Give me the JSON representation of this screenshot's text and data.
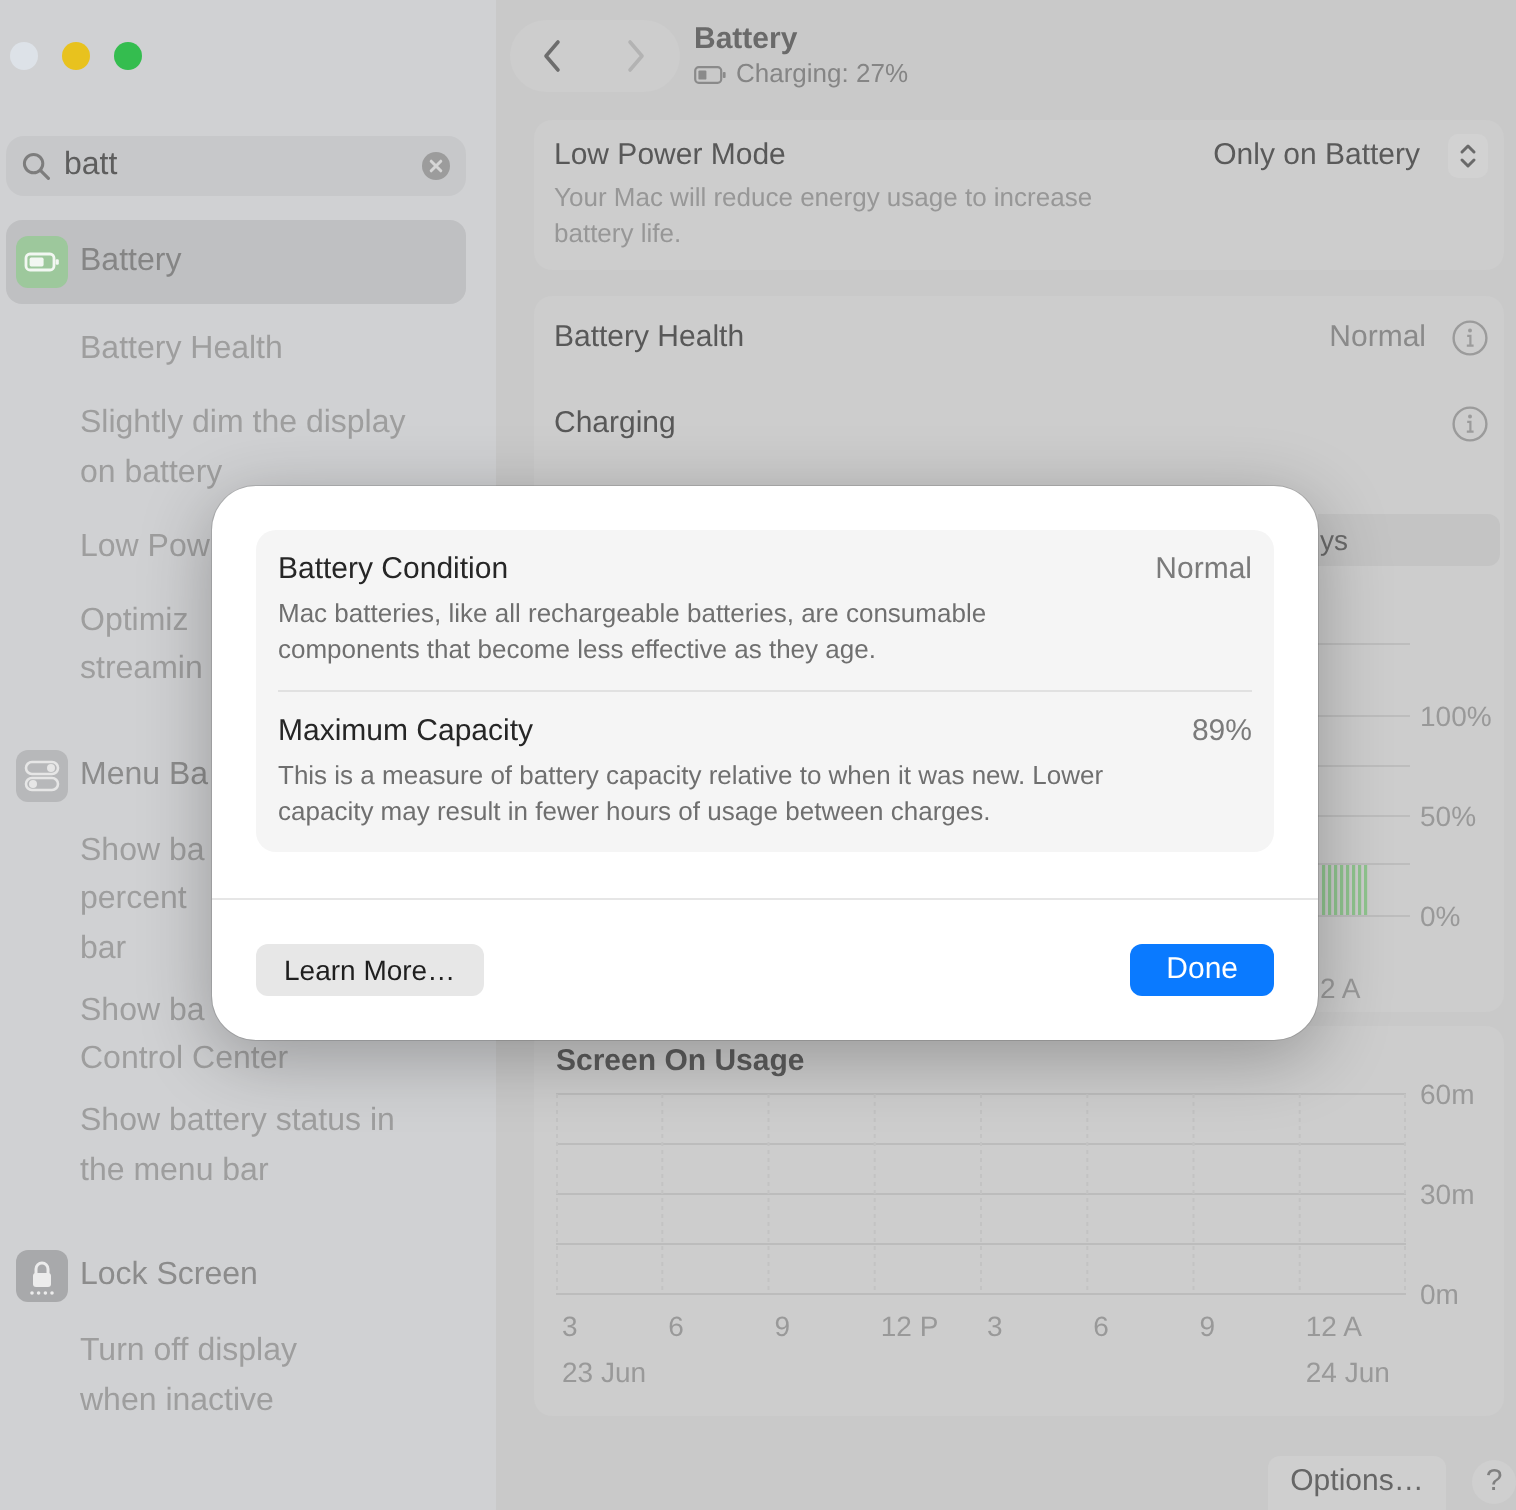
{
  "sidebar": {
    "search": {
      "value": "batt"
    },
    "sections": [
      {
        "kind": "battery",
        "label": "Battery",
        "selected": true,
        "items": [
          {
            "lines": [
              "Battery Health"
            ]
          },
          {
            "lines": [
              "Slightly dim the display",
              "on battery"
            ]
          },
          {
            "lines": [
              "Low Pow"
            ]
          },
          {
            "lines": [
              "Optimiz",
              "streamin"
            ]
          }
        ]
      },
      {
        "kind": "menu_bar",
        "label": "Menu Ba",
        "selected": false,
        "items": [
          {
            "lines": [
              "Show ba",
              "percent",
              "bar"
            ]
          },
          {
            "lines": [
              "Show ba",
              "Control Center"
            ]
          },
          {
            "lines": [
              "Show battery status in",
              "the menu bar"
            ]
          }
        ]
      },
      {
        "kind": "lock",
        "label": "Lock Screen",
        "selected": false,
        "items": [
          {
            "lines": [
              "Turn off display",
              "when inactive"
            ]
          }
        ]
      }
    ]
  },
  "header": {
    "navigation": [
      {
        "kind": "back",
        "disabled": false
      },
      {
        "kind": "forward",
        "disabled": true
      }
    ],
    "title": "Battery",
    "subtitle": "Charging: 27%"
  },
  "low_power": {
    "label": "Low Power Mode",
    "description": "Your Mac will reduce energy usage to increase battery life.",
    "value": "Only on Battery"
  },
  "health_rows": [
    {
      "label": "Battery Health",
      "value": "Normal"
    },
    {
      "label": "Charging"
    }
  ],
  "battery_history": {
    "tab": "ys",
    "y_labels": [
      "100%",
      "50%",
      "0%"
    ],
    "x_label": "2 A"
  },
  "usage_chart": {
    "title": "Screen On Usage",
    "y_labels": [
      "60m",
      "30m",
      "0m"
    ],
    "x_labels": [
      "3",
      "6",
      "9",
      "12 P",
      "3",
      "6",
      "9",
      "12 A"
    ],
    "date_labels": [
      "23 Jun",
      "24 Jun"
    ]
  },
  "bottom_buttons": [
    {
      "kind": "text",
      "label": "Options…"
    },
    {
      "kind": "help",
      "label": "?"
    }
  ],
  "dialog": {
    "rows": [
      {
        "title": "Battery Condition",
        "value": "Normal",
        "description": "Mac batteries, like all rechargeable batteries, are consumable components that become less effective as they age."
      },
      {
        "title": "Maximum Capacity",
        "value": "89%",
        "description": "This is a measure of battery capacity relative to when it was new. Lower capacity may result in fewer hours of usage between charges."
      }
    ],
    "buttons": [
      {
        "kind": "secondary",
        "label": "Learn More…"
      },
      {
        "kind": "primary",
        "label": "Done"
      }
    ]
  }
}
